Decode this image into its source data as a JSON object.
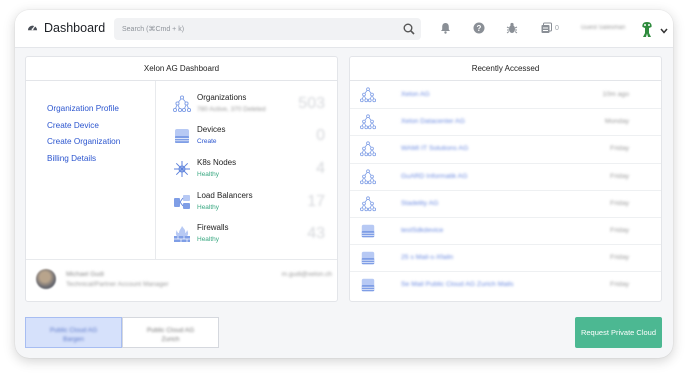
{
  "header": {
    "title": "Dashboard",
    "search_placeholder": "Search (⌘Cmd + k)",
    "notification_count": "0",
    "user_name": "Guest Salesman"
  },
  "left_panel": {
    "title": "Xelon AG Dashboard",
    "links": [
      "Organization Profile",
      "Create Device",
      "Create Organization",
      "Billing Details"
    ],
    "stats": [
      {
        "name": "Organizations",
        "sub": "780 Active, 370 Deleted",
        "value": "503"
      },
      {
        "name": "Devices",
        "sub": "Create",
        "value": "0"
      },
      {
        "name": "K8s Nodes",
        "sub": "Healthy",
        "value": "4"
      },
      {
        "name": "Load Balancers",
        "sub": "Healthy",
        "value": "17"
      },
      {
        "name": "Firewalls",
        "sub": "Healthy",
        "value": "43"
      }
    ],
    "contact": {
      "name": "Michael Gudi",
      "role": "Technical/Partner Account Manager",
      "email": "m.gudi@xelon.ch"
    }
  },
  "right_panel": {
    "title": "Recently Accessed",
    "items": [
      {
        "icon": "org-tree-icon",
        "name": "Xelon AG",
        "time": "10m ago"
      },
      {
        "icon": "org-tree-icon",
        "name": "Xelon Datacenter AG",
        "time": "Monday"
      },
      {
        "icon": "org-tree-icon",
        "name": "WAMI IT Solutions AG",
        "time": "Friday"
      },
      {
        "icon": "org-tree-icon",
        "name": "GuARD Informatik AG",
        "time": "Friday"
      },
      {
        "icon": "org-tree-icon",
        "name": "Stadelity AG",
        "time": "Friday"
      },
      {
        "icon": "device-icon",
        "name": "testSdkdevice",
        "time": "Friday"
      },
      {
        "icon": "device-icon",
        "name": "25 s Mail-s-Xfailn",
        "time": "Friday"
      },
      {
        "icon": "device-icon",
        "name": "Se Mail Public Cloud AG Zurich Mails",
        "time": "Friday"
      }
    ]
  },
  "footer": {
    "tabs": [
      {
        "line1": "Public Cloud AG",
        "line2": "Bargen"
      },
      {
        "line1": "Public Cloud AG",
        "line2": "Zurich"
      }
    ],
    "request_label": "Request Private Cloud"
  },
  "colors": {
    "accent": "#2b55cf",
    "success": "#3aa882",
    "button": "#4cb892",
    "icon": "#7f9ee6"
  }
}
